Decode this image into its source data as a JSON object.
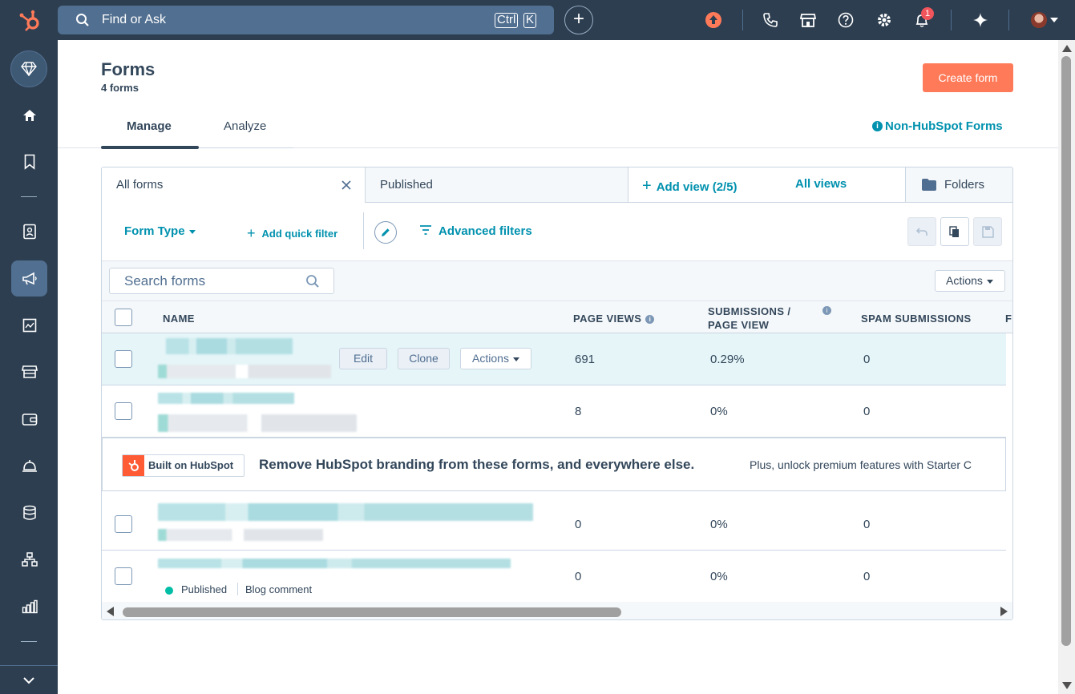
{
  "colors": {
    "nav": "#2d3e50",
    "accent": "#ff7a59",
    "link": "#0091ae",
    "text": "#33475b",
    "highlight_row": "#e5f5f8",
    "published": "#00bda5"
  },
  "topbar": {
    "search_placeholder": "Find or Ask",
    "kbd_ctrl": "Ctrl",
    "kbd_k": "K",
    "notifications_count": "1",
    "icons": [
      "hubspot-logo-icon",
      "search-icon",
      "plus-icon",
      "upgrade-icon",
      "phone-icon",
      "marketplace-icon",
      "help-icon",
      "settings-icon",
      "bell-icon",
      "sparkle-icon",
      "avatar"
    ]
  },
  "sidebar": {
    "items": [
      "gem-icon",
      "home-icon",
      "bookmark-icon",
      "contacts-icon",
      "marketing-icon",
      "content-icon",
      "commerce-icon",
      "wallet-icon",
      "service-icon",
      "data-icon",
      "automation-icon",
      "reporting-icon"
    ],
    "active": "marketing-icon"
  },
  "header": {
    "title": "Forms",
    "subtitle": "4 forms",
    "create_button": "Create form",
    "non_hubspot_link": "Non-HubSpot Forms"
  },
  "tabs": [
    {
      "label": "Manage",
      "active": true
    },
    {
      "label": "Analyze",
      "active": false
    }
  ],
  "views": {
    "all_forms": "All forms",
    "published": "Published",
    "add_view": "Add view (2/5)",
    "all_views": "All views",
    "folders": "Folders"
  },
  "filters": {
    "form_type": "Form Type",
    "add_quick_filter": "Add quick filter",
    "advanced_filters": "Advanced filters"
  },
  "search": {
    "placeholder": "Search forms",
    "actions": "Actions"
  },
  "table": {
    "columns": [
      "NAME",
      "PAGE VIEWS",
      "SUBMISSIONS /",
      "PAGE VIEW",
      "SPAM SUBMISSIONS",
      "F"
    ],
    "rows": [
      {
        "page_views": "691",
        "submissions_rate": "0.29%",
        "spam": "0",
        "actions": {
          "edit": "Edit",
          "clone": "Clone",
          "more": "Actions"
        }
      },
      {
        "page_views": "8",
        "submissions_rate": "0%",
        "spam": "0"
      },
      {
        "page_views": "0",
        "submissions_rate": "0%",
        "spam": "0"
      },
      {
        "page_views": "0",
        "submissions_rate": "0%",
        "spam": "0",
        "status": "Published",
        "type": "Blog comment"
      }
    ]
  },
  "banner": {
    "badge": "Built on HubSpot",
    "heading": "Remove HubSpot branding from these forms, and everywhere else.",
    "text": "Plus, unlock premium features with Starter C"
  }
}
